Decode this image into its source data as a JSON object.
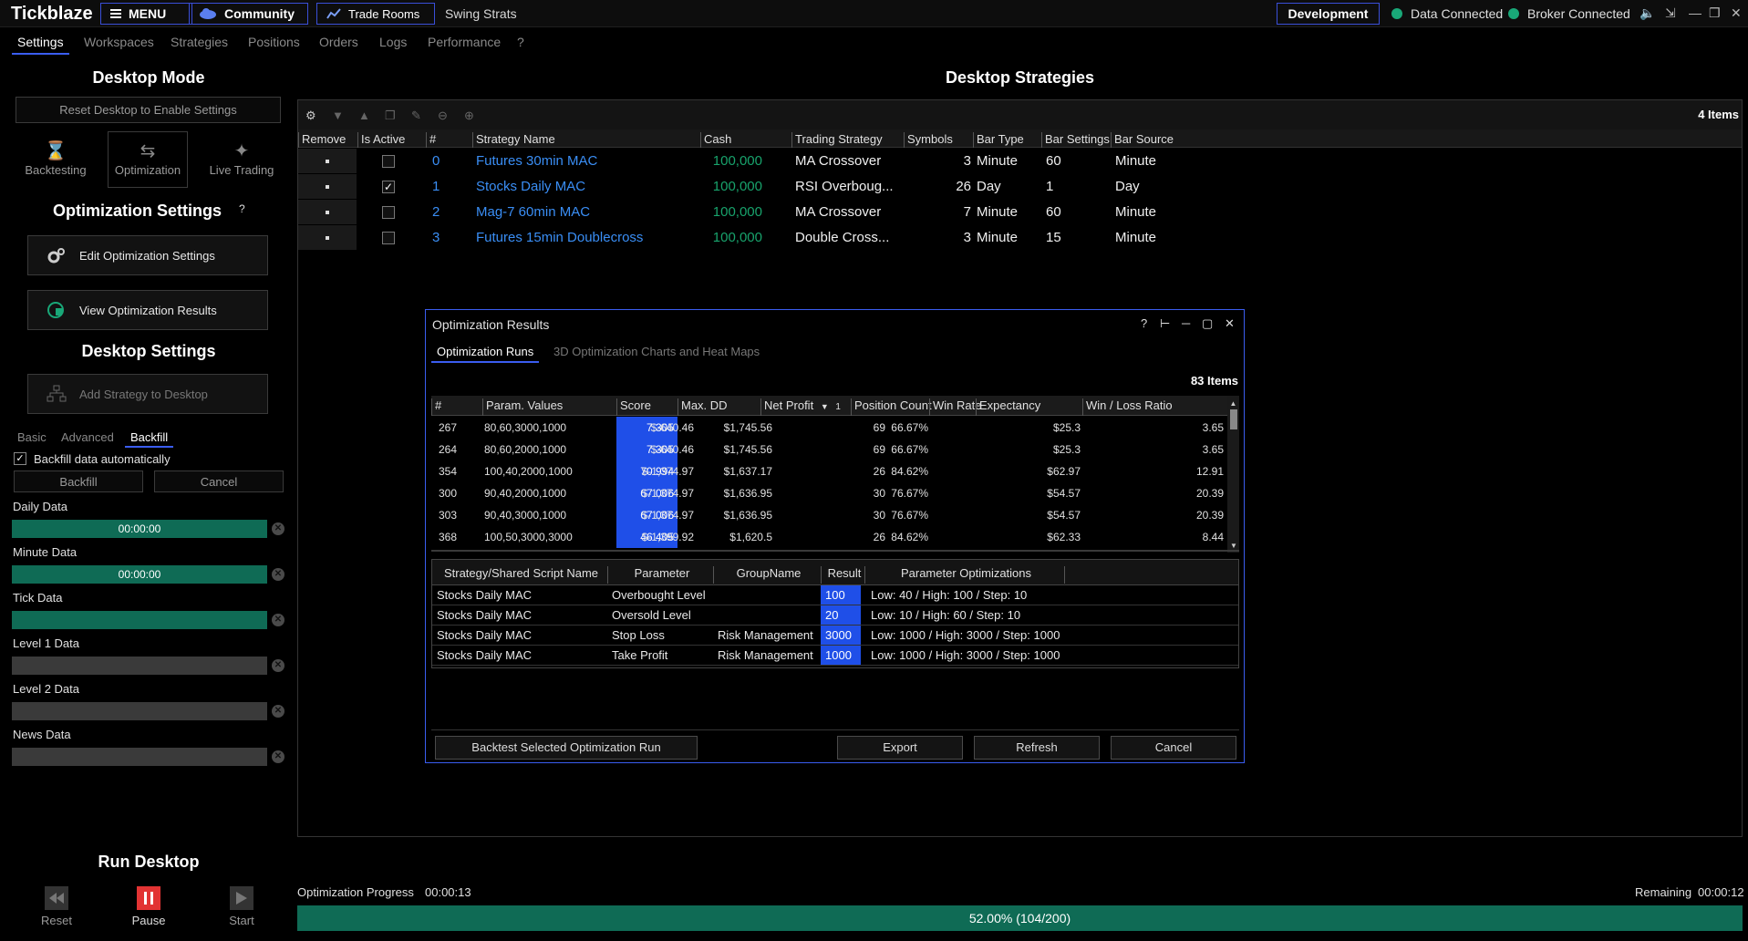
{
  "app": {
    "title": "Tickblaze",
    "menu": "MENU",
    "community": "Community",
    "trade_rooms": "Trade Rooms",
    "swing": "Swing Strats",
    "development": "Development",
    "data_status": "Data Connected",
    "broker_status": "Broker Connected",
    "colors": {
      "accent": "#3a5df0",
      "connected": "#19a878",
      "progress": "#0f6b55",
      "link": "#3a8ef5",
      "value": "#18a36c"
    }
  },
  "tabs": [
    "Settings",
    "Workspaces",
    "Strategies",
    "Positions",
    "Orders",
    "Logs",
    "Performance",
    "?"
  ],
  "left": {
    "desktop_mode": "Desktop Mode",
    "reset_desktop": "Reset Desktop to Enable Settings",
    "modes": [
      "Backtesting",
      "Optimization",
      "Live Trading"
    ],
    "opt_settings_title": "Optimization Settings",
    "help": "?",
    "edit_opt": "Edit Optimization Settings",
    "view_opt": "View Optimization Results",
    "desktop_settings": "Desktop Settings",
    "add_strategy": "Add Strategy to Desktop",
    "subtabs": [
      "Basic",
      "Advanced",
      "Backfill"
    ],
    "backfill_auto": "Backfill data automatically",
    "backfill_btn": "Backfill",
    "cancel_btn": "Cancel",
    "data": [
      {
        "label": "Daily Data",
        "value": "00:00:00",
        "progress": 1
      },
      {
        "label": "Minute Data",
        "value": "00:00:00",
        "progress": 1
      },
      {
        "label": "Tick Data",
        "value": "",
        "progress": 1
      },
      {
        "label": "Level 1 Data",
        "value": "",
        "progress": 0
      },
      {
        "label": "Level 2 Data",
        "value": "",
        "progress": 0
      },
      {
        "label": "News Data",
        "value": "",
        "progress": 0
      }
    ],
    "run_desktop": "Run Desktop",
    "controls": [
      "Reset",
      "Pause",
      "Start"
    ]
  },
  "right": {
    "title": "Desktop Strategies",
    "items": "4 Items",
    "columns": [
      "Remove",
      "Is Active",
      "#",
      "Strategy Name",
      "Cash",
      "Trading Strategy",
      "Symbols",
      "Bar Type",
      "Bar Settings",
      "Bar Source"
    ],
    "rows": [
      {
        "active": false,
        "num": "0",
        "name": "Futures 30min MAC",
        "cash": "100,000",
        "strategy": "MA Crossover",
        "symbols": "3",
        "bar_type": "Minute",
        "bar_settings": "60",
        "bar_source": "Minute"
      },
      {
        "active": true,
        "num": "1",
        "name": "Stocks Daily MAC",
        "cash": "100,000",
        "strategy": "RSI Overboug...",
        "symbols": "26",
        "bar_type": "Day",
        "bar_settings": "1",
        "bar_source": "Day"
      },
      {
        "active": false,
        "num": "2",
        "name": "Mag-7 60min MAC",
        "cash": "100,000",
        "strategy": "MA Crossover",
        "symbols": "7",
        "bar_type": "Minute",
        "bar_settings": "60",
        "bar_source": "Minute"
      },
      {
        "active": false,
        "num": "3",
        "name": "Futures 15min Doublecross",
        "cash": "100,000",
        "strategy": "Double Cross...",
        "symbols": "3",
        "bar_type": "Minute",
        "bar_settings": "15",
        "bar_source": "Minute"
      }
    ]
  },
  "dialog": {
    "title": "Optimization Results",
    "tabs": [
      "Optimization Runs",
      "3D Optimization Charts and Heat Maps"
    ],
    "items": "83 Items",
    "columns": [
      "#",
      "Param. Values",
      "Score",
      "Max. DD",
      "Net Profit",
      "Position Count",
      "Win Rate",
      "Expectancy",
      "Win / Loss Ratio"
    ],
    "sort_index": "1",
    "runs": [
      [
        "267",
        "80,60,3000,1000",
        "7.305",
        "$-640.46",
        "$1,745.56",
        "69",
        "66.67%",
        "$25.3",
        "3.65"
      ],
      [
        "264",
        "80,60,2000,1000",
        "7.305",
        "$-640.46",
        "$1,745.56",
        "69",
        "66.67%",
        "$25.3",
        "3.65"
      ],
      [
        "354",
        "100,40,2000,1000",
        "70.994",
        "$-1,374.97",
        "$1,637.17",
        "26",
        "84.62%",
        "$62.97",
        "12.91"
      ],
      [
        "300",
        "90,40,2000,1000",
        "67.006",
        "$-1,374.97",
        "$1,636.95",
        "30",
        "76.67%",
        "$54.57",
        "20.39"
      ],
      [
        "303",
        "90,40,3000,1000",
        "67.006",
        "$-1,374.97",
        "$1,636.95",
        "30",
        "76.67%",
        "$54.57",
        "20.39"
      ],
      [
        "368",
        "100,50,3000,3000",
        "46.405",
        "$-1,399.92",
        "$1,620.5",
        "26",
        "84.62%",
        "$62.33",
        "8.44"
      ]
    ],
    "param_columns": [
      "Strategy/Shared Script Name",
      "Parameter",
      "GroupName",
      "Result",
      "Parameter Optimizations"
    ],
    "params": [
      [
        "Stocks Daily MAC",
        "Overbought Level",
        "",
        "100",
        "Low: 40 / High: 100 / Step: 10"
      ],
      [
        "Stocks Daily MAC",
        "Oversold Level",
        "",
        "20",
        "Low: 10 / High: 60 / Step: 10"
      ],
      [
        "Stocks Daily MAC",
        "Stop Loss",
        "Risk Management",
        "3000",
        "Low: 1000 / High: 3000 / Step: 1000"
      ],
      [
        "Stocks Daily MAC",
        "Take Profit",
        "Risk Management",
        "1000",
        "Low: 1000 / High: 3000 / Step: 1000"
      ]
    ],
    "buttons": {
      "backtest": "Backtest Selected Optimization Run",
      "export": "Export",
      "refresh": "Refresh",
      "cancel": "Cancel"
    }
  },
  "progress": {
    "label": "Optimization Progress",
    "elapsed": "00:00:13",
    "remaining_label": "Remaining",
    "remaining": "00:00:12",
    "text": "52.00% (104/200)",
    "fraction": 0.52
  }
}
